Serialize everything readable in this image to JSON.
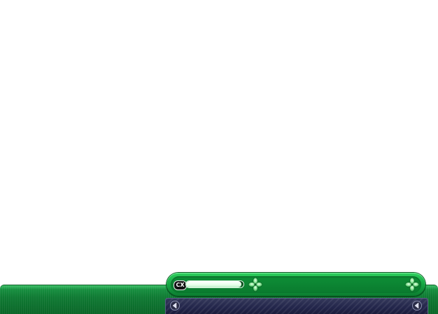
{
  "hud": {
    "gauge_label": "CX",
    "gauge_fill_fraction": 0.96
  },
  "icons": {
    "left_ornament": "four-leaf-clover-icon",
    "right_ornament": "four-leaf-clover-icon",
    "panel_left_arrow": "arrow-left-icon",
    "panel_right_arrow": "arrow-left-icon"
  },
  "colors": {
    "bar_green": "#17a845",
    "band_green": "#0f7a33",
    "panel_navy": "#22254a"
  }
}
